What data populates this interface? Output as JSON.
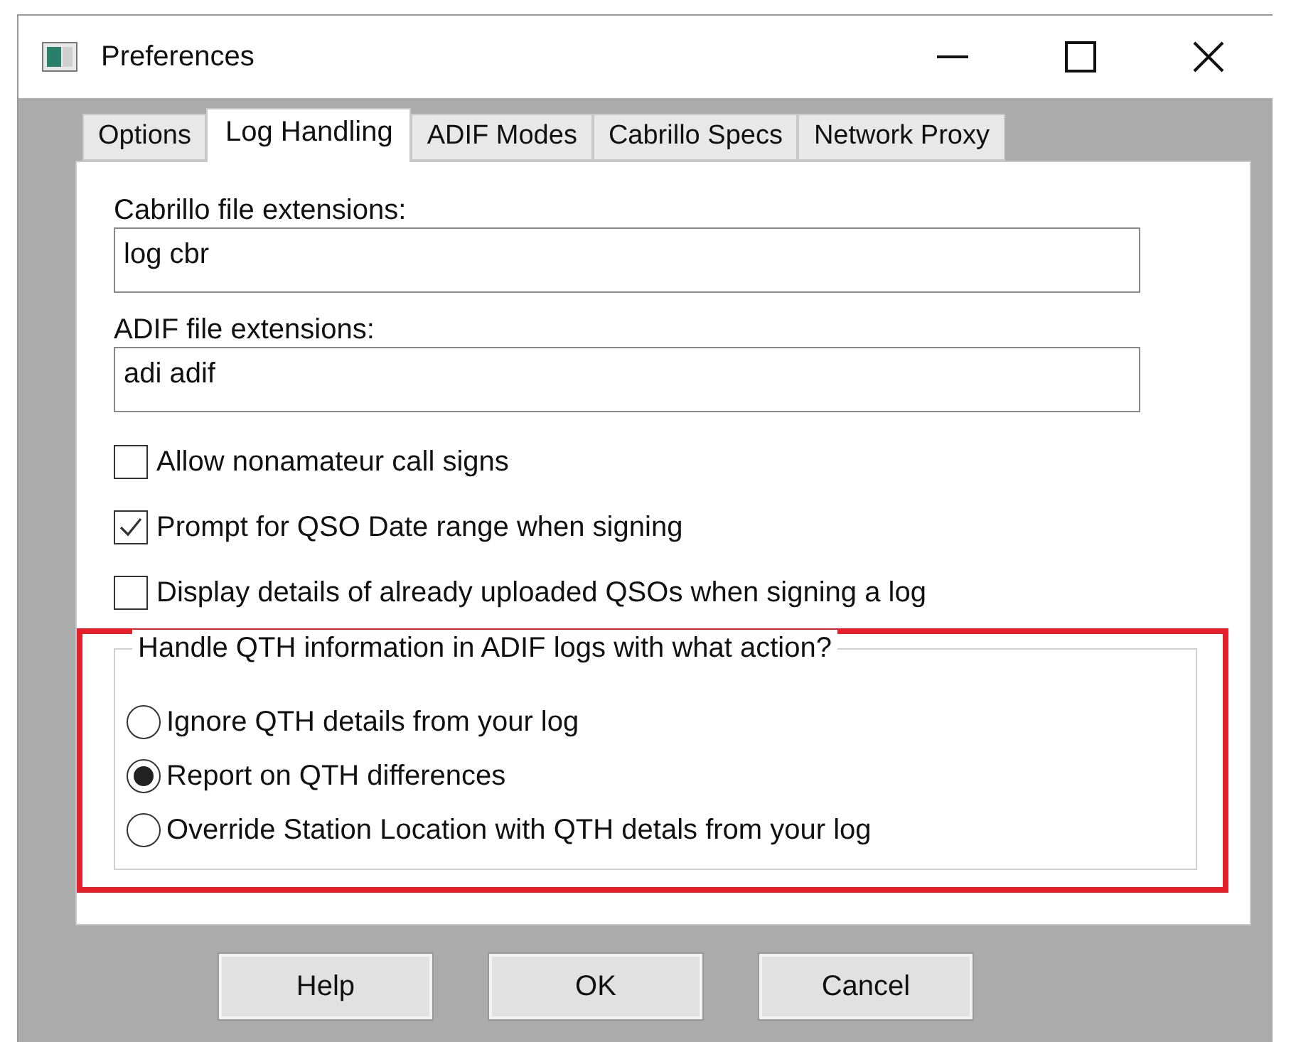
{
  "window": {
    "title": "Preferences"
  },
  "tabs": [
    {
      "label": "Options",
      "selected": false
    },
    {
      "label": "Log Handling",
      "selected": true
    },
    {
      "label": "ADIF Modes",
      "selected": false
    },
    {
      "label": "Cabrillo Specs",
      "selected": false
    },
    {
      "label": "Network Proxy",
      "selected": false
    }
  ],
  "fields": [
    {
      "label": "Cabrillo file extensions:",
      "value": "log cbr"
    },
    {
      "label": "ADIF file extensions:",
      "value": "adi adif"
    }
  ],
  "checkboxes": [
    {
      "label": "Allow nonamateur call signs",
      "checked": false
    },
    {
      "label": "Prompt for QSO Date range when signing",
      "checked": true
    },
    {
      "label": "Display details of already uploaded QSOs when signing a log",
      "checked": false
    }
  ],
  "qth_group": {
    "title": "Handle QTH information in ADIF logs with what action?",
    "highlighted": true,
    "options": [
      {
        "label": "Ignore QTH details from your log",
        "selected": false
      },
      {
        "label": "Report on QTH differences",
        "selected": true
      },
      {
        "label": "Override Station Location with QTH detals from your log",
        "selected": false
      }
    ]
  },
  "buttons": [
    "Help",
    "OK",
    "Cancel"
  ]
}
